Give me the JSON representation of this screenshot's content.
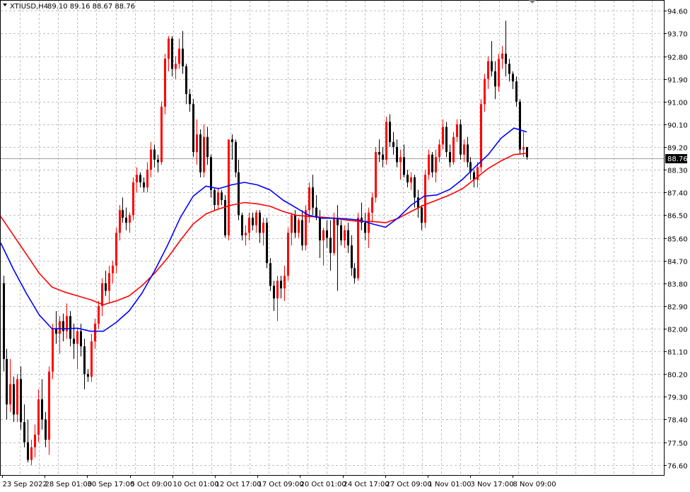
{
  "header": {
    "symbol": "XTIUSD,H4",
    "ohlc": "89.10 89.16 88.67 88.76"
  },
  "colors": {
    "bull": "#ff0000",
    "bear": "#000000",
    "ma_fast": "#0000ff",
    "ma_slow": "#ff0000",
    "grid": "#c0c0c0"
  },
  "chart_data": {
    "type": "candlestick",
    "ylim": [
      76.2,
      95.0
    ],
    "grid": true,
    "y_ticks": [
      "94.60",
      "93.70",
      "92.80",
      "91.90",
      "91.00",
      "90.10",
      "89.20",
      "88.30",
      "87.40",
      "86.50",
      "85.60",
      "84.70",
      "83.80",
      "82.90",
      "82.00",
      "81.10",
      "80.20",
      "79.30",
      "78.40",
      "77.50",
      "76.60"
    ],
    "x_ticks": [
      "23 Sep 2022",
      "28 Sep 01:00",
      "30 Sep 17:00",
      "5 Oct 09:00",
      "10 Oct 01:00",
      "12 Oct 17:00",
      "17 Oct 09:00",
      "20 Oct 01:00",
      "24 Oct 17:00",
      "27 Oct 09:00",
      "1 Nov 01:00",
      "3 Nov 17:00",
      "8 Nov 09:00"
    ],
    "last_price": "88.76",
    "series": [
      {
        "name": "bars",
        "candles": [
          [
            83.8,
            84.1,
            80.3,
            80.8
          ],
          [
            80.8,
            81.2,
            78.4,
            79.0
          ],
          [
            79.0,
            80.8,
            78.7,
            79.8
          ],
          [
            79.8,
            80.1,
            78.3,
            78.6
          ],
          [
            78.6,
            80.2,
            78.3,
            80.0
          ],
          [
            80.0,
            80.5,
            78.0,
            78.3
          ],
          [
            78.3,
            79.0,
            77.3,
            77.5
          ],
          [
            77.5,
            78.4,
            76.7,
            76.8
          ],
          [
            76.8,
            77.6,
            76.6,
            77.3
          ],
          [
            77.3,
            78.2,
            76.9,
            77.8
          ],
          [
            77.8,
            79.6,
            77.5,
            79.2
          ],
          [
            79.2,
            80.0,
            78.0,
            78.4
          ],
          [
            78.4,
            78.7,
            77.3,
            77.6
          ],
          [
            77.6,
            80.5,
            77.0,
            80.3
          ],
          [
            80.3,
            82.2,
            80.0,
            82.0
          ],
          [
            82.0,
            82.7,
            81.4,
            81.8
          ],
          [
            81.8,
            82.5,
            81.0,
            82.3
          ],
          [
            82.3,
            82.6,
            81.5,
            81.9
          ],
          [
            81.9,
            83.0,
            81.6,
            82.5
          ],
          [
            82.5,
            82.7,
            81.3,
            81.6
          ],
          [
            81.6,
            82.2,
            80.8,
            81.4
          ],
          [
            81.4,
            82.0,
            80.4,
            81.9
          ],
          [
            81.9,
            82.2,
            80.9,
            81.3
          ],
          [
            81.3,
            81.6,
            79.6,
            80.2
          ],
          [
            80.2,
            80.4,
            79.9,
            80.1
          ],
          [
            80.1,
            81.8,
            79.9,
            81.5
          ],
          [
            81.5,
            82.4,
            81.2,
            82.2
          ],
          [
            82.2,
            83.1,
            82.0,
            82.9
          ],
          [
            82.9,
            84.0,
            82.5,
            83.8
          ],
          [
            83.8,
            84.3,
            83.3,
            83.5
          ],
          [
            83.5,
            84.5,
            83.0,
            84.2
          ],
          [
            84.2,
            84.7,
            83.8,
            84.5
          ],
          [
            84.5,
            86.0,
            84.2,
            85.8
          ],
          [
            85.8,
            86.9,
            85.5,
            86.7
          ],
          [
            86.7,
            87.2,
            86.2,
            86.4
          ],
          [
            86.4,
            86.8,
            85.9,
            86.2
          ],
          [
            86.2,
            86.6,
            85.8,
            86.5
          ],
          [
            86.5,
            88.0,
            86.3,
            87.8
          ],
          [
            87.8,
            88.4,
            87.4,
            88.1
          ],
          [
            88.1,
            88.2,
            87.6,
            87.8
          ],
          [
            87.8,
            88.0,
            87.4,
            87.6
          ],
          [
            87.6,
            88.6,
            87.4,
            88.3
          ],
          [
            88.3,
            89.4,
            88.0,
            89.1
          ],
          [
            89.1,
            89.3,
            88.4,
            88.7
          ],
          [
            88.7,
            88.9,
            88.2,
            88.6
          ],
          [
            88.6,
            91.0,
            88.5,
            90.8
          ],
          [
            90.8,
            92.9,
            90.5,
            92.7
          ],
          [
            92.7,
            93.6,
            92.2,
            93.5
          ],
          [
            93.5,
            93.6,
            92.0,
            92.3
          ],
          [
            92.3,
            92.8,
            91.9,
            92.5
          ],
          [
            92.5,
            93.5,
            92.3,
            93.1
          ],
          [
            93.1,
            93.8,
            92.1,
            92.4
          ],
          [
            92.4,
            92.5,
            90.9,
            91.3
          ],
          [
            91.3,
            91.5,
            90.6,
            90.9
          ],
          [
            90.9,
            91.1,
            88.8,
            89.0
          ],
          [
            89.0,
            90.3,
            88.5,
            89.7
          ],
          [
            89.7,
            89.9,
            88.0,
            88.2
          ],
          [
            88.2,
            90.1,
            88.0,
            89.6
          ],
          [
            89.6,
            90.0,
            88.5,
            88.8
          ],
          [
            88.8,
            88.9,
            87.2,
            87.5
          ],
          [
            87.5,
            87.6,
            86.7,
            86.9
          ],
          [
            86.9,
            87.6,
            86.7,
            87.4
          ],
          [
            87.4,
            87.5,
            86.9,
            87.1
          ],
          [
            87.1,
            87.3,
            85.6,
            85.7
          ],
          [
            85.7,
            88.8,
            85.5,
            89.5
          ],
          [
            89.5,
            89.7,
            88.7,
            89.4
          ],
          [
            89.4,
            89.5,
            88.0,
            88.2
          ],
          [
            88.2,
            88.7,
            86.3,
            86.5
          ],
          [
            86.5,
            86.6,
            85.5,
            85.7
          ],
          [
            85.7,
            86.1,
            85.3,
            85.8
          ],
          [
            85.8,
            86.6,
            85.5,
            86.4
          ],
          [
            86.4,
            86.6,
            85.9,
            86.1
          ],
          [
            86.1,
            86.7,
            85.8,
            86.6
          ],
          [
            86.6,
            86.7,
            85.4,
            85.8
          ],
          [
            85.8,
            86.4,
            85.3,
            86.2
          ],
          [
            86.2,
            86.4,
            84.4,
            84.6
          ],
          [
            84.6,
            84.8,
            83.5,
            83.7
          ],
          [
            83.7,
            83.9,
            82.7,
            83.2
          ],
          [
            83.2,
            84.1,
            82.3,
            83.9
          ],
          [
            83.9,
            84.1,
            83.2,
            83.6
          ],
          [
            83.6,
            84.5,
            83.1,
            84.1
          ],
          [
            84.1,
            86.0,
            83.9,
            85.8
          ],
          [
            85.8,
            86.6,
            85.3,
            86.5
          ],
          [
            86.5,
            86.7,
            85.6,
            85.8
          ],
          [
            85.8,
            86.4,
            85.6,
            86.3
          ],
          [
            86.3,
            86.7,
            85.1,
            85.3
          ],
          [
            85.3,
            86.9,
            85.1,
            86.7
          ],
          [
            86.7,
            87.8,
            86.2,
            87.6
          ],
          [
            87.6,
            88.1,
            86.5,
            86.8
          ],
          [
            86.8,
            87.3,
            86.3,
            86.4
          ],
          [
            86.4,
            86.7,
            84.8,
            85.5
          ],
          [
            85.5,
            86.0,
            84.5,
            85.9
          ],
          [
            85.9,
            86.3,
            85.2,
            85.6
          ],
          [
            85.6,
            86.3,
            84.3,
            85.0
          ],
          [
            85.0,
            86.6,
            84.9,
            86.4
          ],
          [
            86.4,
            86.9,
            83.5,
            86.1
          ],
          [
            86.1,
            86.3,
            85.3,
            85.5
          ],
          [
            85.5,
            86.1,
            85.2,
            85.9
          ],
          [
            85.9,
            86.2,
            85.0,
            85.3
          ],
          [
            85.3,
            85.7,
            84.1,
            84.4
          ],
          [
            84.4,
            84.6,
            83.8,
            84.0
          ],
          [
            84.0,
            86.6,
            83.9,
            86.4
          ],
          [
            86.4,
            87.0,
            85.9,
            86.2
          ],
          [
            86.2,
            86.6,
            85.5,
            85.8
          ],
          [
            85.8,
            86.8,
            85.2,
            86.6
          ],
          [
            86.6,
            87.4,
            86.2,
            87.2
          ],
          [
            87.2,
            89.2,
            87.0,
            89.0
          ],
          [
            89.0,
            89.5,
            88.6,
            88.9
          ],
          [
            88.9,
            89.2,
            88.4,
            88.7
          ],
          [
            88.7,
            90.4,
            88.5,
            90.2
          ],
          [
            90.2,
            90.5,
            89.2,
            89.4
          ],
          [
            89.4,
            89.8,
            88.9,
            89.2
          ],
          [
            89.2,
            89.5,
            88.4,
            88.6
          ],
          [
            88.6,
            89.1,
            87.9,
            88.8
          ],
          [
            88.8,
            89.3,
            88.0,
            88.1
          ],
          [
            88.1,
            88.3,
            87.6,
            87.8
          ],
          [
            87.8,
            88.2,
            87.5,
            88.0
          ],
          [
            88.0,
            88.1,
            86.8,
            87.2
          ],
          [
            87.2,
            87.5,
            86.4,
            86.8
          ],
          [
            86.8,
            86.9,
            85.9,
            86.2
          ],
          [
            86.2,
            88.3,
            86.0,
            88.1
          ],
          [
            88.1,
            89.1,
            87.9,
            88.9
          ],
          [
            88.9,
            89.0,
            88.0,
            88.2
          ],
          [
            88.2,
            89.1,
            87.8,
            88.8
          ],
          [
            88.8,
            89.5,
            88.6,
            89.3
          ],
          [
            89.3,
            90.3,
            89.1,
            90.0
          ],
          [
            90.0,
            90.2,
            88.8,
            89.0
          ],
          [
            89.0,
            89.3,
            88.4,
            88.6
          ],
          [
            88.6,
            89.8,
            88.5,
            89.6
          ],
          [
            89.6,
            90.3,
            89.4,
            90.1
          ],
          [
            90.1,
            90.3,
            88.7,
            88.9
          ],
          [
            88.9,
            89.5,
            88.6,
            89.3
          ],
          [
            89.3,
            89.6,
            88.4,
            88.6
          ],
          [
            88.6,
            88.8,
            87.9,
            88.2
          ],
          [
            88.2,
            88.3,
            87.6,
            87.9
          ],
          [
            87.9,
            88.6,
            87.6,
            88.4
          ],
          [
            88.4,
            91.1,
            88.2,
            90.9
          ],
          [
            90.9,
            92.1,
            90.6,
            91.9
          ],
          [
            91.9,
            92.8,
            91.5,
            92.6
          ],
          [
            92.6,
            93.4,
            92.0,
            92.2
          ],
          [
            92.2,
            92.6,
            91.1,
            91.6
          ],
          [
            91.6,
            92.9,
            91.4,
            92.7
          ],
          [
            92.7,
            93.2,
            92.3,
            92.9
          ],
          [
            92.9,
            94.2,
            92.0,
            92.5
          ],
          [
            92.5,
            92.7,
            91.8,
            92.1
          ],
          [
            92.1,
            92.2,
            91.5,
            91.8
          ],
          [
            91.8,
            92.0,
            90.8,
            91.0
          ],
          [
            91.0,
            91.1,
            88.9,
            89.1
          ],
          [
            89.1,
            89.8,
            88.8,
            89.2
          ],
          [
            89.2,
            89.2,
            88.7,
            88.8
          ]
        ]
      },
      {
        "name": "ma_fast_path",
        "values": [
          85.4,
          84.35,
          83.4,
          82.55,
          82.0,
          82.0,
          82.02,
          81.9,
          81.9,
          82.25,
          82.7,
          83.4,
          84.3,
          85.3,
          86.4,
          87.25,
          87.65,
          87.55,
          87.7,
          87.8,
          87.7,
          87.5,
          87.1,
          86.8,
          86.5,
          86.38,
          86.38,
          86.35,
          86.3,
          86.15,
          86.02,
          86.4,
          86.9,
          87.25,
          87.3,
          87.52,
          87.92,
          88.42,
          88.9,
          89.55,
          89.95,
          89.8
        ]
      },
      {
        "name": "ma_slow_path",
        "values": [
          86.45,
          85.7,
          84.95,
          84.2,
          83.65,
          83.45,
          83.3,
          83.15,
          82.95,
          83.1,
          83.3,
          83.7,
          84.2,
          84.8,
          85.5,
          86.15,
          86.55,
          86.75,
          86.9,
          87.0,
          86.95,
          86.85,
          86.65,
          86.5,
          86.45,
          86.42,
          86.38,
          86.3,
          86.25,
          86.25,
          86.2,
          86.38,
          86.65,
          86.9,
          87.1,
          87.3,
          87.55,
          87.95,
          88.35,
          88.65,
          88.9,
          88.95
        ]
      }
    ]
  }
}
